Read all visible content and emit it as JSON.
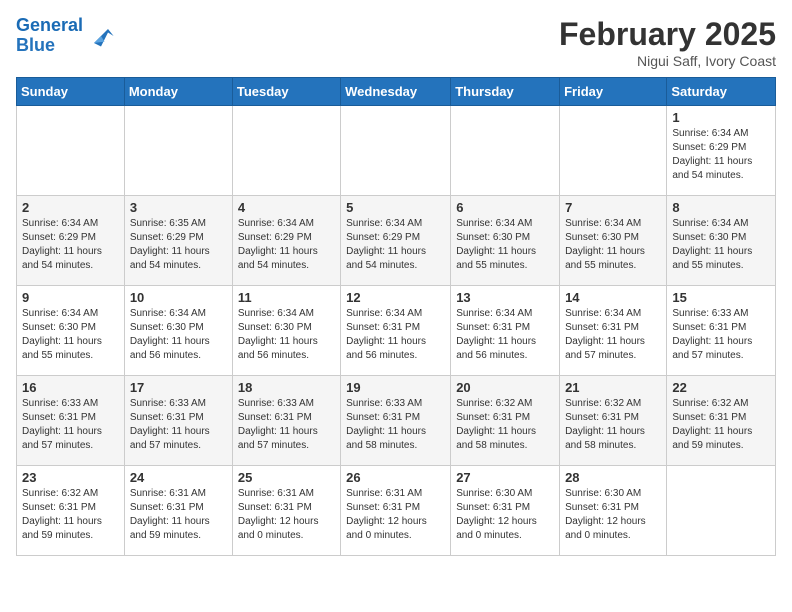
{
  "logo": {
    "line1": "General",
    "line2": "Blue"
  },
  "title": "February 2025",
  "subtitle": "Nigui Saff, Ivory Coast",
  "weekdays": [
    "Sunday",
    "Monday",
    "Tuesday",
    "Wednesday",
    "Thursday",
    "Friday",
    "Saturday"
  ],
  "weeks": [
    [
      {
        "day": "",
        "info": ""
      },
      {
        "day": "",
        "info": ""
      },
      {
        "day": "",
        "info": ""
      },
      {
        "day": "",
        "info": ""
      },
      {
        "day": "",
        "info": ""
      },
      {
        "day": "",
        "info": ""
      },
      {
        "day": "1",
        "info": "Sunrise: 6:34 AM\nSunset: 6:29 PM\nDaylight: 11 hours\nand 54 minutes."
      }
    ],
    [
      {
        "day": "2",
        "info": "Sunrise: 6:34 AM\nSunset: 6:29 PM\nDaylight: 11 hours\nand 54 minutes."
      },
      {
        "day": "3",
        "info": "Sunrise: 6:35 AM\nSunset: 6:29 PM\nDaylight: 11 hours\nand 54 minutes."
      },
      {
        "day": "4",
        "info": "Sunrise: 6:34 AM\nSunset: 6:29 PM\nDaylight: 11 hours\nand 54 minutes."
      },
      {
        "day": "5",
        "info": "Sunrise: 6:34 AM\nSunset: 6:29 PM\nDaylight: 11 hours\nand 54 minutes."
      },
      {
        "day": "6",
        "info": "Sunrise: 6:34 AM\nSunset: 6:30 PM\nDaylight: 11 hours\nand 55 minutes."
      },
      {
        "day": "7",
        "info": "Sunrise: 6:34 AM\nSunset: 6:30 PM\nDaylight: 11 hours\nand 55 minutes."
      },
      {
        "day": "8",
        "info": "Sunrise: 6:34 AM\nSunset: 6:30 PM\nDaylight: 11 hours\nand 55 minutes."
      }
    ],
    [
      {
        "day": "9",
        "info": "Sunrise: 6:34 AM\nSunset: 6:30 PM\nDaylight: 11 hours\nand 55 minutes."
      },
      {
        "day": "10",
        "info": "Sunrise: 6:34 AM\nSunset: 6:30 PM\nDaylight: 11 hours\nand 56 minutes."
      },
      {
        "day": "11",
        "info": "Sunrise: 6:34 AM\nSunset: 6:30 PM\nDaylight: 11 hours\nand 56 minutes."
      },
      {
        "day": "12",
        "info": "Sunrise: 6:34 AM\nSunset: 6:31 PM\nDaylight: 11 hours\nand 56 minutes."
      },
      {
        "day": "13",
        "info": "Sunrise: 6:34 AM\nSunset: 6:31 PM\nDaylight: 11 hours\nand 56 minutes."
      },
      {
        "day": "14",
        "info": "Sunrise: 6:34 AM\nSunset: 6:31 PM\nDaylight: 11 hours\nand 57 minutes."
      },
      {
        "day": "15",
        "info": "Sunrise: 6:33 AM\nSunset: 6:31 PM\nDaylight: 11 hours\nand 57 minutes."
      }
    ],
    [
      {
        "day": "16",
        "info": "Sunrise: 6:33 AM\nSunset: 6:31 PM\nDaylight: 11 hours\nand 57 minutes."
      },
      {
        "day": "17",
        "info": "Sunrise: 6:33 AM\nSunset: 6:31 PM\nDaylight: 11 hours\nand 57 minutes."
      },
      {
        "day": "18",
        "info": "Sunrise: 6:33 AM\nSunset: 6:31 PM\nDaylight: 11 hours\nand 57 minutes."
      },
      {
        "day": "19",
        "info": "Sunrise: 6:33 AM\nSunset: 6:31 PM\nDaylight: 11 hours\nand 58 minutes."
      },
      {
        "day": "20",
        "info": "Sunrise: 6:32 AM\nSunset: 6:31 PM\nDaylight: 11 hours\nand 58 minutes."
      },
      {
        "day": "21",
        "info": "Sunrise: 6:32 AM\nSunset: 6:31 PM\nDaylight: 11 hours\nand 58 minutes."
      },
      {
        "day": "22",
        "info": "Sunrise: 6:32 AM\nSunset: 6:31 PM\nDaylight: 11 hours\nand 59 minutes."
      }
    ],
    [
      {
        "day": "23",
        "info": "Sunrise: 6:32 AM\nSunset: 6:31 PM\nDaylight: 11 hours\nand 59 minutes."
      },
      {
        "day": "24",
        "info": "Sunrise: 6:31 AM\nSunset: 6:31 PM\nDaylight: 11 hours\nand 59 minutes."
      },
      {
        "day": "25",
        "info": "Sunrise: 6:31 AM\nSunset: 6:31 PM\nDaylight: 12 hours\nand 0 minutes."
      },
      {
        "day": "26",
        "info": "Sunrise: 6:31 AM\nSunset: 6:31 PM\nDaylight: 12 hours\nand 0 minutes."
      },
      {
        "day": "27",
        "info": "Sunrise: 6:30 AM\nSunset: 6:31 PM\nDaylight: 12 hours\nand 0 minutes."
      },
      {
        "day": "28",
        "info": "Sunrise: 6:30 AM\nSunset: 6:31 PM\nDaylight: 12 hours\nand 0 minutes."
      },
      {
        "day": "",
        "info": ""
      }
    ]
  ]
}
